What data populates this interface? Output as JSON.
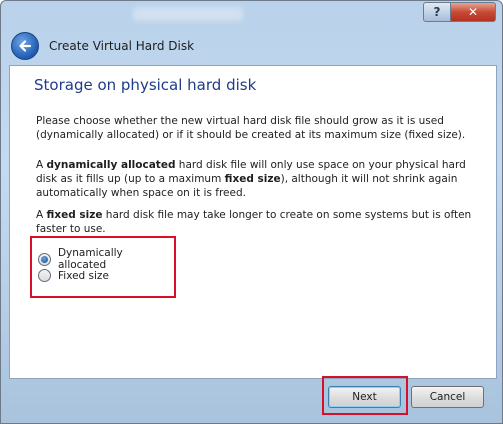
{
  "window": {
    "title": "Create Virtual Hard Disk",
    "help_label": "?",
    "close_label": "✕"
  },
  "page": {
    "heading": "Storage on physical hard disk",
    "intro": "Please choose whether the new virtual hard disk file should grow as it is used (dynamically allocated) or if it should be created at its maximum size (fixed size).",
    "dynamic_desc": {
      "pre": "A ",
      "bold1": "dynamically allocated",
      "mid": " hard disk file will only use space on your physical hard disk as it fills up (up to a maximum ",
      "bold2": "fixed size",
      "post": "), although it will not shrink again automatically when space on it is freed."
    },
    "fixed_desc": {
      "pre": "A ",
      "bold": "fixed size",
      "post": " hard disk file may take longer to create on some systems but is often faster to use."
    }
  },
  "options": [
    {
      "label": "Dynamically allocated",
      "selected": true
    },
    {
      "label": "Fixed size",
      "selected": false
    }
  ],
  "buttons": {
    "next": "Next",
    "cancel": "Cancel"
  },
  "colors": {
    "highlight": "#d6102a",
    "heading": "#1f3c8a"
  }
}
